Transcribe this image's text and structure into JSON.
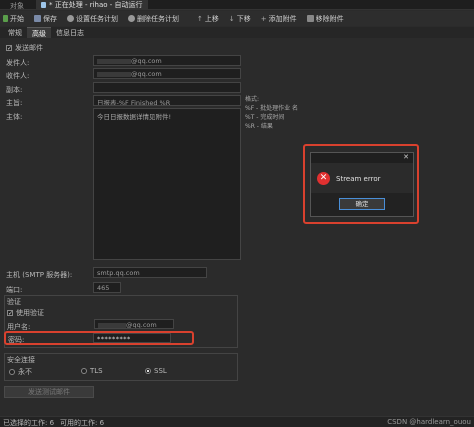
{
  "titlebar": {
    "left_label": "对象",
    "tab_title": "* 正在处理 - rihao - 自动运行"
  },
  "toolbar": {
    "start": "开始",
    "save": "保存",
    "set_schedule": "设置任务计划",
    "delete_schedule": "删除任务计划",
    "move_up": "上移",
    "move_down": "下移",
    "add_attachment": "添加附件",
    "remove_attachment": "移除附件"
  },
  "tabs": [
    "常规",
    "高级",
    "信息日志"
  ],
  "form": {
    "send_email_label": "发送邮件",
    "sender_label": "发件人:",
    "sender_value": "@qq.com",
    "recipient_label": "收件人:",
    "recipient_value": "@qq.com",
    "cc_label": "副本:",
    "subject_label": "主旨:",
    "subject_value": "日报表-%F Finished %R",
    "body_label": "主体:",
    "body_value": "今日日报数据详情见附件!",
    "format_hint": "格式:\n%F - 批处理作业 名\n%T - 完成时间\n%R - 结果",
    "host_label": "主机 (SMTP 服务器):",
    "host_value": "smtp.qq.com",
    "port_label": "端口:",
    "port_value": "465"
  },
  "auth": {
    "section_label": "验证",
    "use_auth_label": "使用验证",
    "username_label": "用户名:",
    "username_value": "@qq.com",
    "password_label": "密码:",
    "password_value": "*********"
  },
  "security": {
    "section_label": "安全连接",
    "options": [
      "永不",
      "TLS",
      "SSL"
    ],
    "selected": "SSL"
  },
  "send_test_button": "发送测试邮件",
  "dialog": {
    "message": "Stream error",
    "ok_button": "确定",
    "close_glyph": "✕"
  },
  "statusbar": {
    "selected_jobs": "已选择的工作: 6",
    "available_jobs": "可用的工作: 6",
    "watermark": "CSDN @hardlearn_ouou"
  },
  "colors": {
    "highlight_red": "#d9412e",
    "error_icon": "#e03030",
    "dialog_ok_border": "#4a8fd8"
  }
}
